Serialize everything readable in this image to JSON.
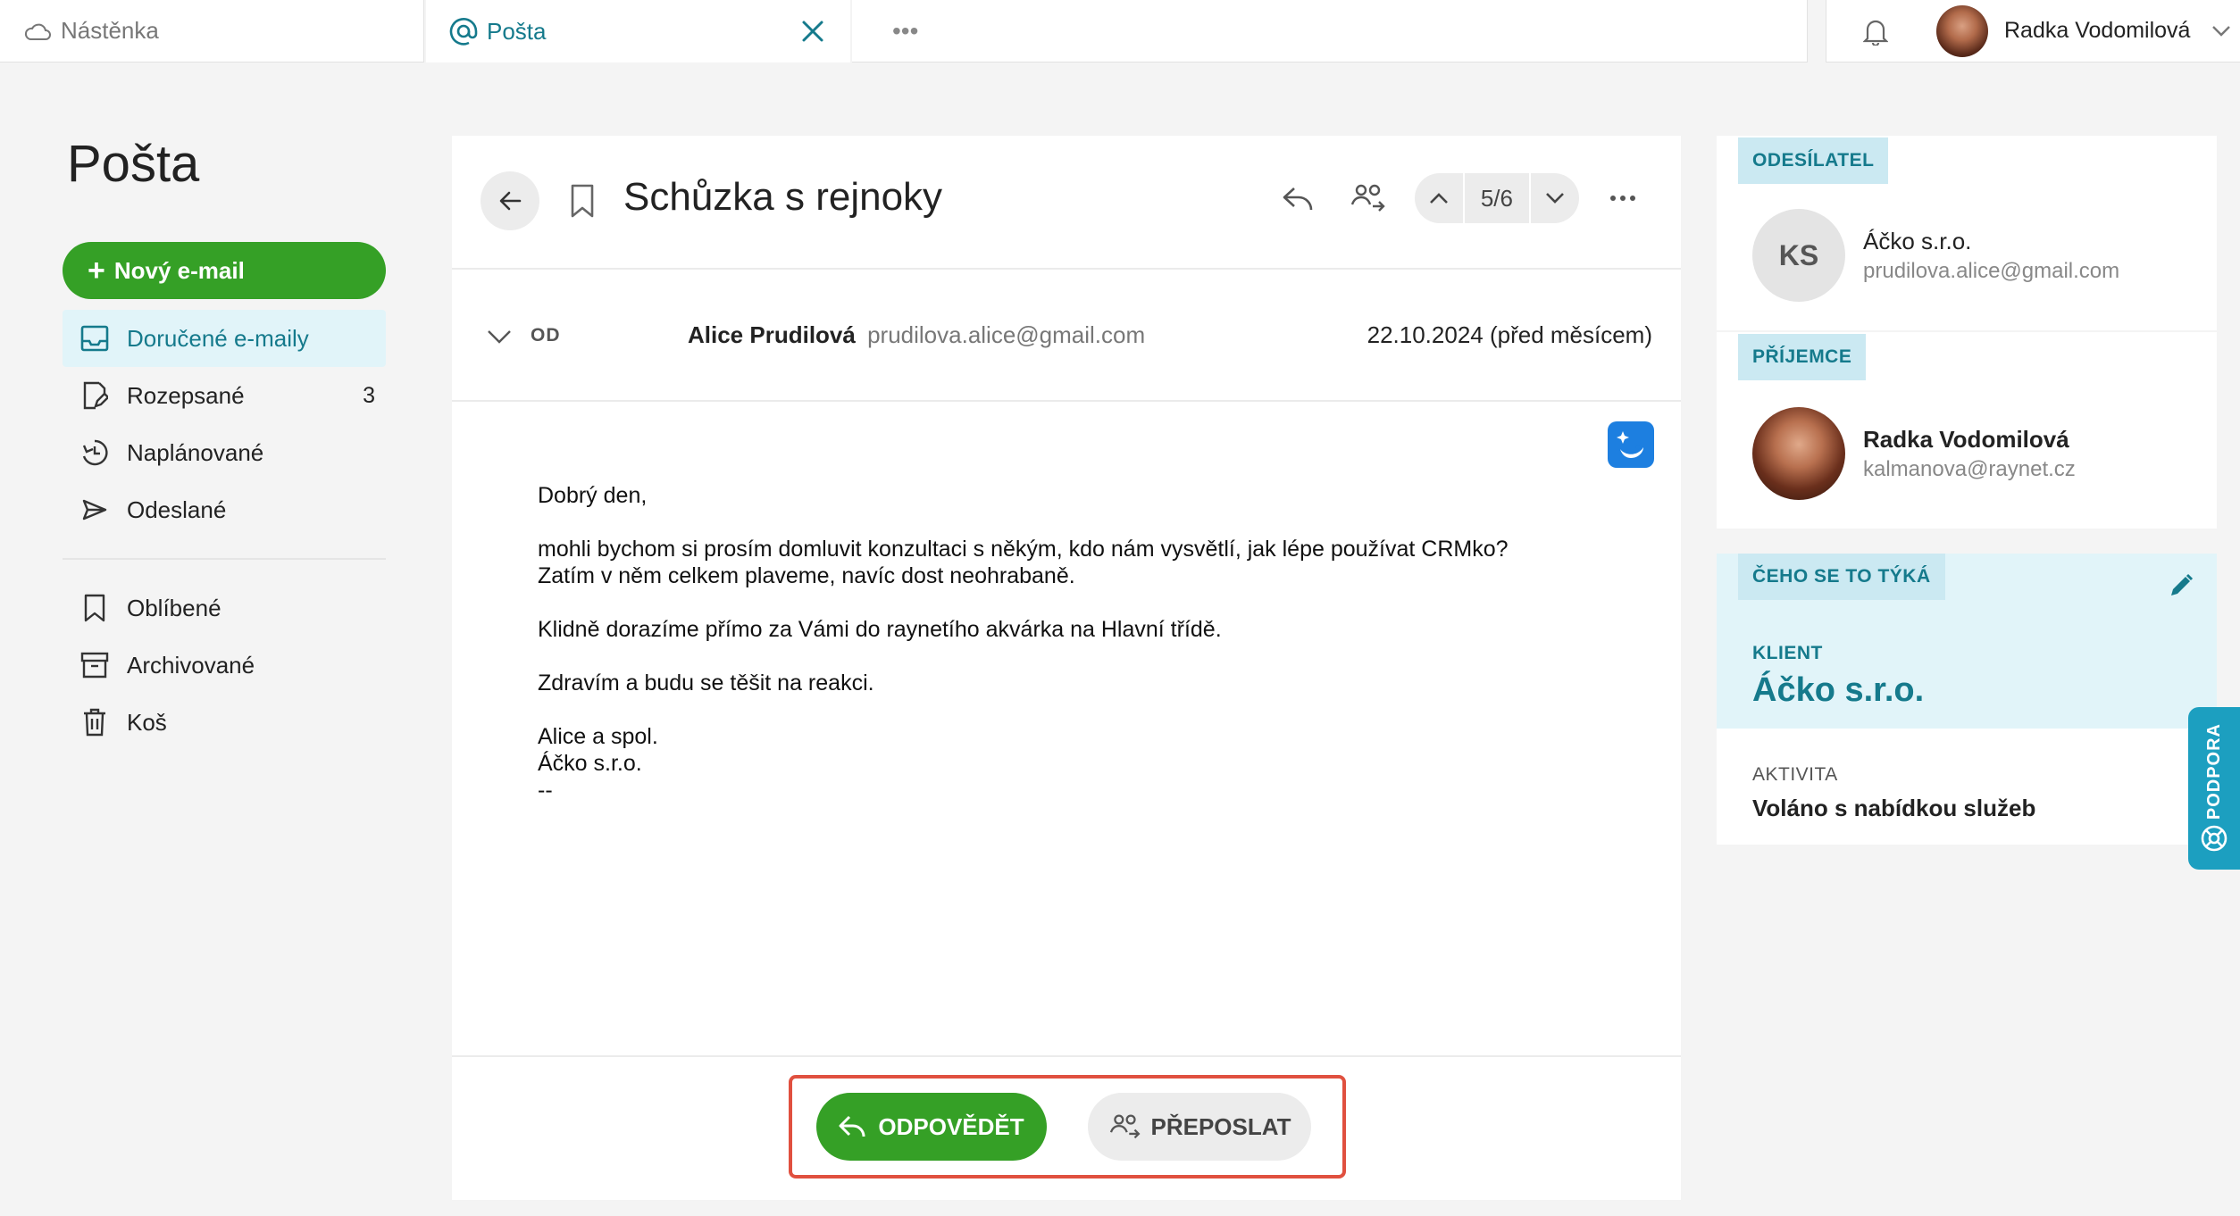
{
  "tabs": {
    "dashboard": "Nástěnka",
    "mail": "Pošta",
    "more": "•••"
  },
  "user": {
    "name": "Radka Vodomilová"
  },
  "sidebar": {
    "title": "Pošta",
    "new_email": "Nový e-mail",
    "items": [
      {
        "label": "Doručené e-maily",
        "icon": "inbox-icon",
        "active": true
      },
      {
        "label": "Rozepsané",
        "icon": "draft-icon",
        "count": "3"
      },
      {
        "label": "Naplánované",
        "icon": "scheduled-icon"
      },
      {
        "label": "Odeslané",
        "icon": "sent-icon"
      }
    ],
    "items2": [
      {
        "label": "Oblíbené",
        "icon": "bookmark-icon"
      },
      {
        "label": "Archivované",
        "icon": "archive-icon"
      },
      {
        "label": "Koš",
        "icon": "trash-icon"
      }
    ]
  },
  "mail": {
    "subject": "Schůzka s rejnoky",
    "pager": "5/6",
    "from_label": "OD",
    "from_name": "Alice Prudilová",
    "from_email": "prudilova.alice@gmail.com",
    "date": "22.10.2024 (před měsícem)",
    "body": {
      "greeting": "Dobrý den,",
      "p1_line1": "mohli bychom si prosím domluvit konzultaci s někým, kdo nám vysvětlí, jak lépe používat CRMko?",
      "p1_line2": "Zatím v něm celkem plaveme, navíc dost neohrabaně.",
      "p2": "Klidně dorazíme přímo za Vámi do raynetího akvárka na Hlavní třídě.",
      "p3": "Zdravím a budu se těšit na reakci.",
      "sig1": "Alice a spol.",
      "sig2": "Áčko s.r.o.",
      "sig3": "--"
    },
    "reply_label": "ODPOVĚDĚT",
    "forward_label": "PŘEPOSLAT"
  },
  "right": {
    "sender_label": "ODESÍLATEL",
    "sender_initials": "KS",
    "sender_name": "Áčko s.r.o.",
    "sender_email": "prudilova.alice@gmail.com",
    "recipient_label": "PŘÍJEMCE",
    "recipient_name": "Radka Vodomilová",
    "recipient_email": "kalmanova@raynet.cz",
    "concern_label": "ČEHO SE TO TÝKÁ",
    "client_label": "KLIENT",
    "client_value": "Áčko s.r.o.",
    "activity_label": "AKTIVITA",
    "activity_value": "Voláno s nabídkou služeb"
  },
  "support_label": "PODPORA",
  "colors": {
    "accent": "#157a8c",
    "green": "#35a026",
    "highlight": "#e0503f",
    "light_blue": "#e1f4f9"
  }
}
